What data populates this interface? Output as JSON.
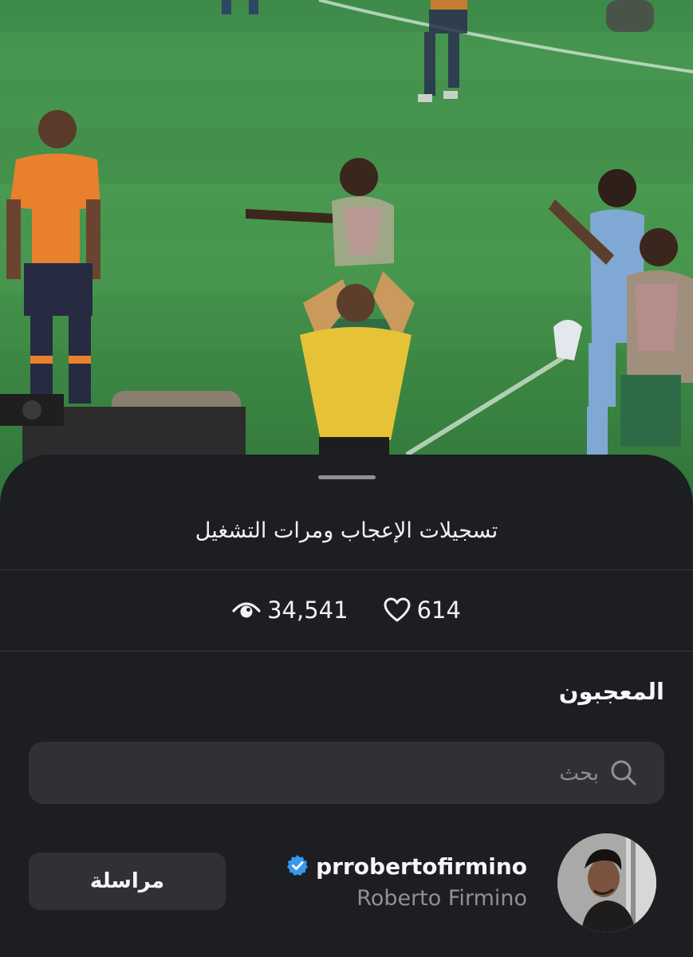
{
  "sheet": {
    "title": "تسجيلات الإعجاب ومرات التشغيل"
  },
  "stats": {
    "views": "34,541",
    "views_icon": "eye-icon",
    "likes": "614",
    "likes_icon": "heart-icon"
  },
  "likers_section": {
    "title": "المعجبون"
  },
  "search": {
    "placeholder": "بحث",
    "value": "",
    "icon": "search-icon"
  },
  "likers": [
    {
      "username": "prrobertofirmino",
      "full_name": "Roberto Firmino",
      "verified": true,
      "action_label": "مراسلة"
    }
  ],
  "colors": {
    "sheet_background": "#1c1e22",
    "field_background": "#2f3136",
    "secondary_text": "#8f9196",
    "verified_badge": "#3897f0"
  }
}
